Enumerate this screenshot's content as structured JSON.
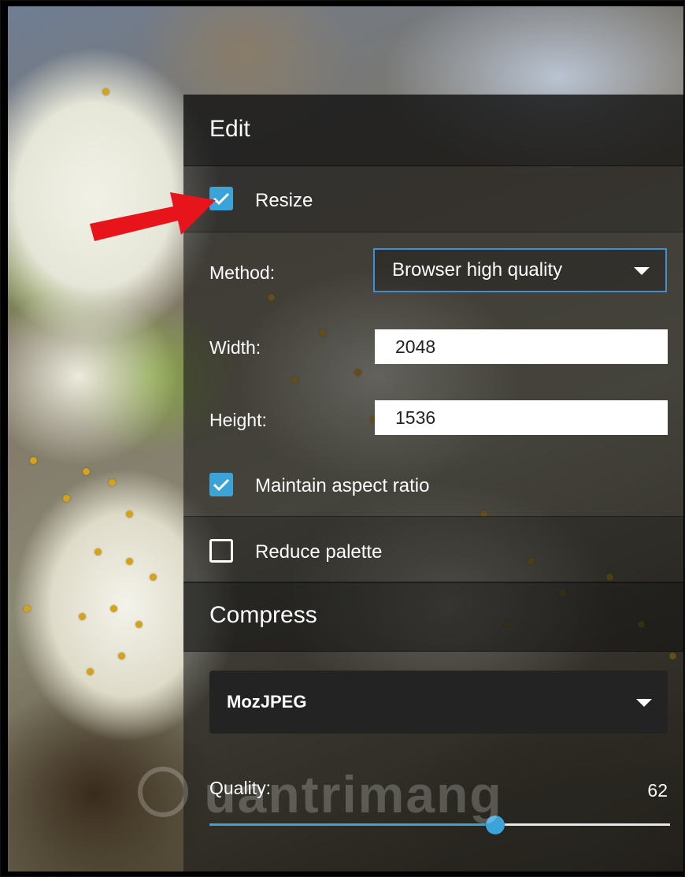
{
  "edit": {
    "title": "Edit",
    "resize_label": "Resize",
    "resize_checked": true,
    "method_label": "Method:",
    "method_value": "Browser high quality",
    "width_label": "Width:",
    "width_value": "2048",
    "height_label": "Height:",
    "height_value": "1536",
    "maintain_label": "Maintain aspect ratio",
    "maintain_checked": true,
    "reduce_label": "Reduce palette",
    "reduce_checked": false
  },
  "compress": {
    "title": "Compress",
    "codec_value": "MozJPEG",
    "quality_label": "Quality:",
    "quality_value": "62",
    "quality_fraction": 0.62
  },
  "watermark_text": "uantrimang",
  "colors": {
    "accent": "#3ba3d8",
    "select_border": "#3f8fd6",
    "arrow": "#e8141c"
  },
  "icons": {
    "checkbox_checked": "check-icon",
    "dropdown": "caret-down-icon",
    "annotation": "red-arrow-icon"
  }
}
